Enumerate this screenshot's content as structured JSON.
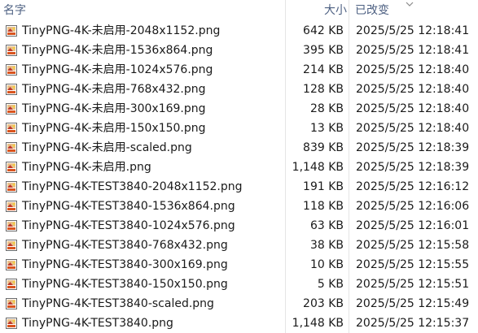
{
  "columns": {
    "name": "名字",
    "size": "大小",
    "date": "已改变"
  },
  "files": [
    {
      "name": "TinyPNG-4K-未启用-2048x1152.png",
      "size": "642 KB",
      "modified": "2025/5/25 12:18:41"
    },
    {
      "name": "TinyPNG-4K-未启用-1536x864.png",
      "size": "395 KB",
      "modified": "2025/5/25 12:18:41"
    },
    {
      "name": "TinyPNG-4K-未启用-1024x576.png",
      "size": "214 KB",
      "modified": "2025/5/25 12:18:40"
    },
    {
      "name": "TinyPNG-4K-未启用-768x432.png",
      "size": "128 KB",
      "modified": "2025/5/25 12:18:40"
    },
    {
      "name": "TinyPNG-4K-未启用-300x169.png",
      "size": "28 KB",
      "modified": "2025/5/25 12:18:40"
    },
    {
      "name": "TinyPNG-4K-未启用-150x150.png",
      "size": "13 KB",
      "modified": "2025/5/25 12:18:40"
    },
    {
      "name": "TinyPNG-4K-未启用-scaled.png",
      "size": "839 KB",
      "modified": "2025/5/25 12:18:39"
    },
    {
      "name": "TinyPNG-4K-未启用.png",
      "size": "1,148 KB",
      "modified": "2025/5/25 12:18:39"
    },
    {
      "name": "TinyPNG-4K-TEST3840-2048x1152.png",
      "size": "191 KB",
      "modified": "2025/5/25 12:16:12"
    },
    {
      "name": "TinyPNG-4K-TEST3840-1536x864.png",
      "size": "118 KB",
      "modified": "2025/5/25 12:16:06"
    },
    {
      "name": "TinyPNG-4K-TEST3840-1024x576.png",
      "size": "63 KB",
      "modified": "2025/5/25 12:16:01"
    },
    {
      "name": "TinyPNG-4K-TEST3840-768x432.png",
      "size": "38 KB",
      "modified": "2025/5/25 12:15:58"
    },
    {
      "name": "TinyPNG-4K-TEST3840-300x169.png",
      "size": "10 KB",
      "modified": "2025/5/25 12:15:55"
    },
    {
      "name": "TinyPNG-4K-TEST3840-150x150.png",
      "size": "5 KB",
      "modified": "2025/5/25 12:15:51"
    },
    {
      "name": "TinyPNG-4K-TEST3840-scaled.png",
      "size": "203 KB",
      "modified": "2025/5/25 12:15:49"
    },
    {
      "name": "TinyPNG-4K-TEST3840.png",
      "size": "1,148 KB",
      "modified": "2025/5/25 12:15:37"
    }
  ],
  "icon": "png-image-file-icon",
  "colors": {
    "header_text": "#4d6082",
    "separator": "#e5e5e5",
    "icon_accent": "#d9541e"
  }
}
